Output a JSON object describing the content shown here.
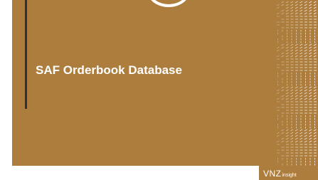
{
  "slide": {
    "title": "SAF Orderbook Database",
    "background_color": "#ad7d3d",
    "accent_line_color": "#2e2e4a",
    "decorations": [
      "top-circle-outline",
      "hatched-line-pattern"
    ]
  },
  "logo": {
    "brand": "VNZ",
    "suffix": "insight"
  }
}
